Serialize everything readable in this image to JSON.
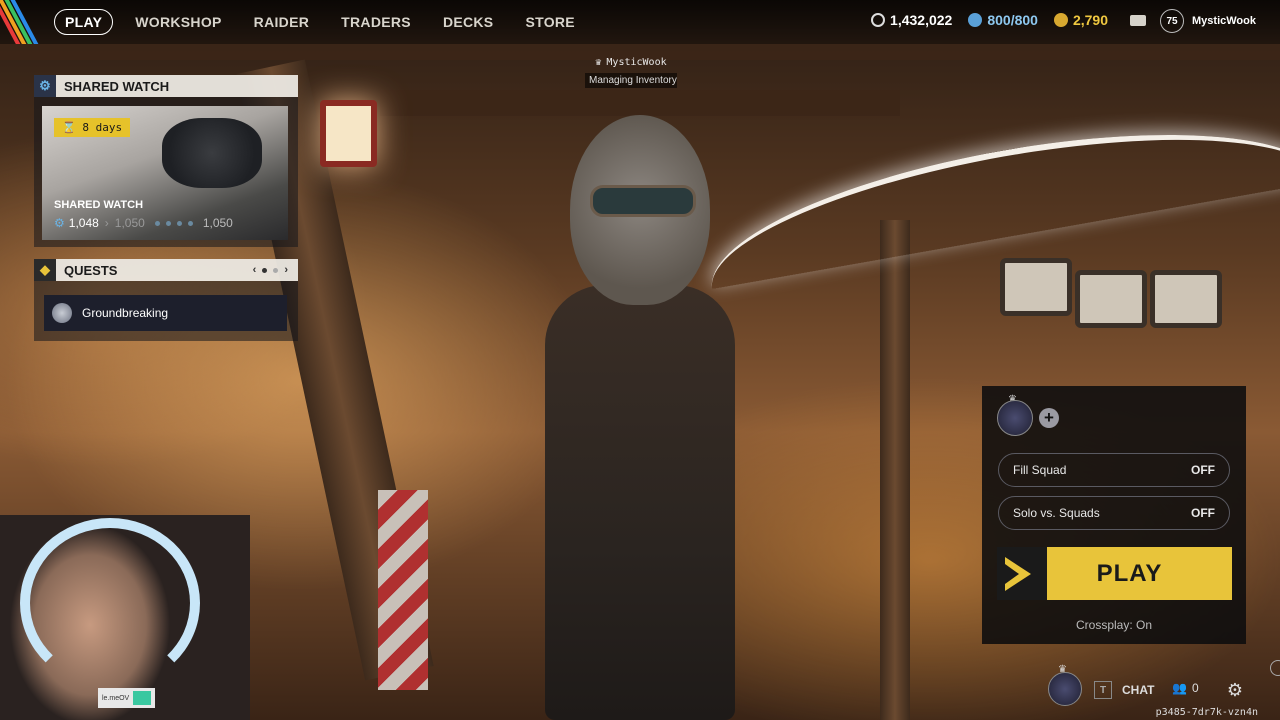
{
  "nav": {
    "items": [
      "PLAY",
      "WORKSHOP",
      "RAIDER",
      "TRADERS",
      "DECKS",
      "STORE"
    ],
    "active": "PLAY"
  },
  "currencies": {
    "coins": "1,432,022",
    "credits": "800/800",
    "tokens": "2,790"
  },
  "profile": {
    "level": "75",
    "username": "MysticWook"
  },
  "shared_watch": {
    "header": "SHARED WATCH",
    "badge": "8 days",
    "title": "SHARED WATCH",
    "progress_current": "1,048",
    "progress_next": "1,050",
    "progress_target": "1,050"
  },
  "quests": {
    "header": "QUESTS",
    "page_prev": "‹",
    "page_next": "›",
    "items": [
      {
        "label": "Groundbreaking"
      }
    ]
  },
  "nameplate": {
    "name": "MysticWook",
    "status": "Managing Inventory"
  },
  "squad": {
    "add_label": "+",
    "fill_squad_label": "Fill Squad",
    "fill_squad_value": "OFF",
    "solo_vs_squads_label": "Solo vs. Squads",
    "solo_vs_squads_value": "OFF",
    "play_label": "PLAY",
    "crossplay": "Crossplay: On"
  },
  "bottom": {
    "chat_key": "T",
    "chat_label": "CHAT",
    "friends_count": "0",
    "session_id": "p3485-7dr7k-vzn4n"
  },
  "stream_overlay": {
    "tag": "le.meOV"
  },
  "colors": {
    "accent_yellow": "#e8c43a",
    "panel_header": "#ebe8e1",
    "panel_icon_bg": "#2a3348"
  }
}
